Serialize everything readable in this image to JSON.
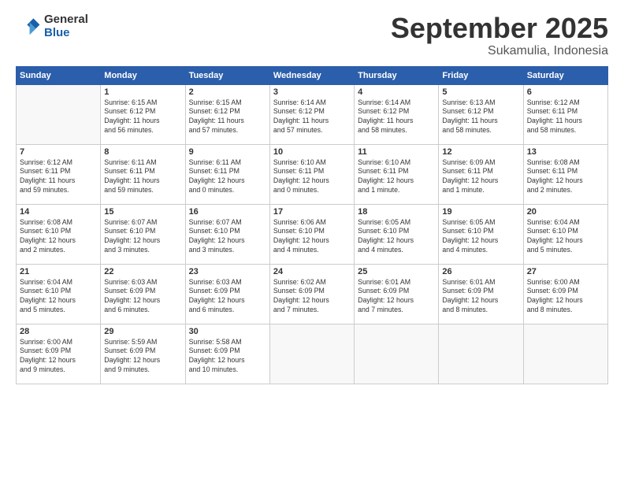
{
  "logo": {
    "line1": "General",
    "line2": "Blue"
  },
  "title": "September 2025",
  "subtitle": "Sukamulia, Indonesia",
  "days_header": [
    "Sunday",
    "Monday",
    "Tuesday",
    "Wednesday",
    "Thursday",
    "Friday",
    "Saturday"
  ],
  "weeks": [
    [
      {
        "day": "",
        "text": ""
      },
      {
        "day": "1",
        "text": "Sunrise: 6:15 AM\nSunset: 6:12 PM\nDaylight: 11 hours\nand 56 minutes."
      },
      {
        "day": "2",
        "text": "Sunrise: 6:15 AM\nSunset: 6:12 PM\nDaylight: 11 hours\nand 57 minutes."
      },
      {
        "day": "3",
        "text": "Sunrise: 6:14 AM\nSunset: 6:12 PM\nDaylight: 11 hours\nand 57 minutes."
      },
      {
        "day": "4",
        "text": "Sunrise: 6:14 AM\nSunset: 6:12 PM\nDaylight: 11 hours\nand 58 minutes."
      },
      {
        "day": "5",
        "text": "Sunrise: 6:13 AM\nSunset: 6:12 PM\nDaylight: 11 hours\nand 58 minutes."
      },
      {
        "day": "6",
        "text": "Sunrise: 6:12 AM\nSunset: 6:11 PM\nDaylight: 11 hours\nand 58 minutes."
      }
    ],
    [
      {
        "day": "7",
        "text": "Sunrise: 6:12 AM\nSunset: 6:11 PM\nDaylight: 11 hours\nand 59 minutes."
      },
      {
        "day": "8",
        "text": "Sunrise: 6:11 AM\nSunset: 6:11 PM\nDaylight: 11 hours\nand 59 minutes."
      },
      {
        "day": "9",
        "text": "Sunrise: 6:11 AM\nSunset: 6:11 PM\nDaylight: 12 hours\nand 0 minutes."
      },
      {
        "day": "10",
        "text": "Sunrise: 6:10 AM\nSunset: 6:11 PM\nDaylight: 12 hours\nand 0 minutes."
      },
      {
        "day": "11",
        "text": "Sunrise: 6:10 AM\nSunset: 6:11 PM\nDaylight: 12 hours\nand 1 minute."
      },
      {
        "day": "12",
        "text": "Sunrise: 6:09 AM\nSunset: 6:11 PM\nDaylight: 12 hours\nand 1 minute."
      },
      {
        "day": "13",
        "text": "Sunrise: 6:08 AM\nSunset: 6:11 PM\nDaylight: 12 hours\nand 2 minutes."
      }
    ],
    [
      {
        "day": "14",
        "text": "Sunrise: 6:08 AM\nSunset: 6:10 PM\nDaylight: 12 hours\nand 2 minutes."
      },
      {
        "day": "15",
        "text": "Sunrise: 6:07 AM\nSunset: 6:10 PM\nDaylight: 12 hours\nand 3 minutes."
      },
      {
        "day": "16",
        "text": "Sunrise: 6:07 AM\nSunset: 6:10 PM\nDaylight: 12 hours\nand 3 minutes."
      },
      {
        "day": "17",
        "text": "Sunrise: 6:06 AM\nSunset: 6:10 PM\nDaylight: 12 hours\nand 4 minutes."
      },
      {
        "day": "18",
        "text": "Sunrise: 6:05 AM\nSunset: 6:10 PM\nDaylight: 12 hours\nand 4 minutes."
      },
      {
        "day": "19",
        "text": "Sunrise: 6:05 AM\nSunset: 6:10 PM\nDaylight: 12 hours\nand 4 minutes."
      },
      {
        "day": "20",
        "text": "Sunrise: 6:04 AM\nSunset: 6:10 PM\nDaylight: 12 hours\nand 5 minutes."
      }
    ],
    [
      {
        "day": "21",
        "text": "Sunrise: 6:04 AM\nSunset: 6:10 PM\nDaylight: 12 hours\nand 5 minutes."
      },
      {
        "day": "22",
        "text": "Sunrise: 6:03 AM\nSunset: 6:09 PM\nDaylight: 12 hours\nand 6 minutes."
      },
      {
        "day": "23",
        "text": "Sunrise: 6:03 AM\nSunset: 6:09 PM\nDaylight: 12 hours\nand 6 minutes."
      },
      {
        "day": "24",
        "text": "Sunrise: 6:02 AM\nSunset: 6:09 PM\nDaylight: 12 hours\nand 7 minutes."
      },
      {
        "day": "25",
        "text": "Sunrise: 6:01 AM\nSunset: 6:09 PM\nDaylight: 12 hours\nand 7 minutes."
      },
      {
        "day": "26",
        "text": "Sunrise: 6:01 AM\nSunset: 6:09 PM\nDaylight: 12 hours\nand 8 minutes."
      },
      {
        "day": "27",
        "text": "Sunrise: 6:00 AM\nSunset: 6:09 PM\nDaylight: 12 hours\nand 8 minutes."
      }
    ],
    [
      {
        "day": "28",
        "text": "Sunrise: 6:00 AM\nSunset: 6:09 PM\nDaylight: 12 hours\nand 9 minutes."
      },
      {
        "day": "29",
        "text": "Sunrise: 5:59 AM\nSunset: 6:09 PM\nDaylight: 12 hours\nand 9 minutes."
      },
      {
        "day": "30",
        "text": "Sunrise: 5:58 AM\nSunset: 6:09 PM\nDaylight: 12 hours\nand 10 minutes."
      },
      {
        "day": "",
        "text": ""
      },
      {
        "day": "",
        "text": ""
      },
      {
        "day": "",
        "text": ""
      },
      {
        "day": "",
        "text": ""
      }
    ]
  ]
}
